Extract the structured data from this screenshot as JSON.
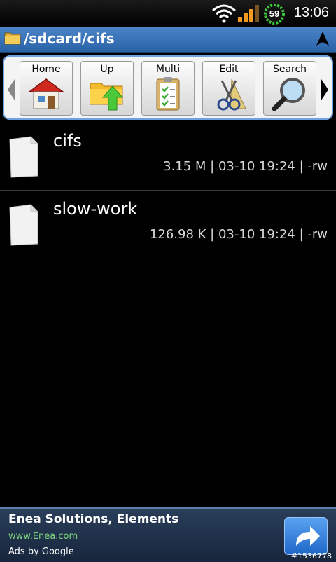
{
  "status": {
    "time": "13:06",
    "battery": "59",
    "icons": [
      "wifi-icon",
      "signal-icon",
      "battery-icon"
    ]
  },
  "path": {
    "current": "/sdcard/cifs",
    "folder_icon": "folder-icon",
    "nav_icon": "navigation-arrow-icon"
  },
  "toolbar": {
    "buttons": [
      {
        "label": "Home",
        "icon": "house-icon"
      },
      {
        "label": "Up",
        "icon": "folder-up-icon"
      },
      {
        "label": "Multi",
        "icon": "clipboard-check-icon"
      },
      {
        "label": "Edit",
        "icon": "scissors-icon"
      },
      {
        "label": "Search",
        "icon": "magnifier-icon"
      }
    ]
  },
  "files": [
    {
      "name": "cifs",
      "meta": "3.15 M | 03-10 19:24 | -rw"
    },
    {
      "name": "slow-work",
      "meta": "126.98 K | 03-10 19:24 | -rw"
    }
  ],
  "ad": {
    "title": "Enea Solutions, Elements",
    "url": "www.Enea.com",
    "by": "Ads by Google",
    "id": "#1536778"
  },
  "colors": {
    "pathbar": "#2a62a8",
    "toolbar_border": "#6fa2e0",
    "ad_url": "#7fd27f"
  }
}
